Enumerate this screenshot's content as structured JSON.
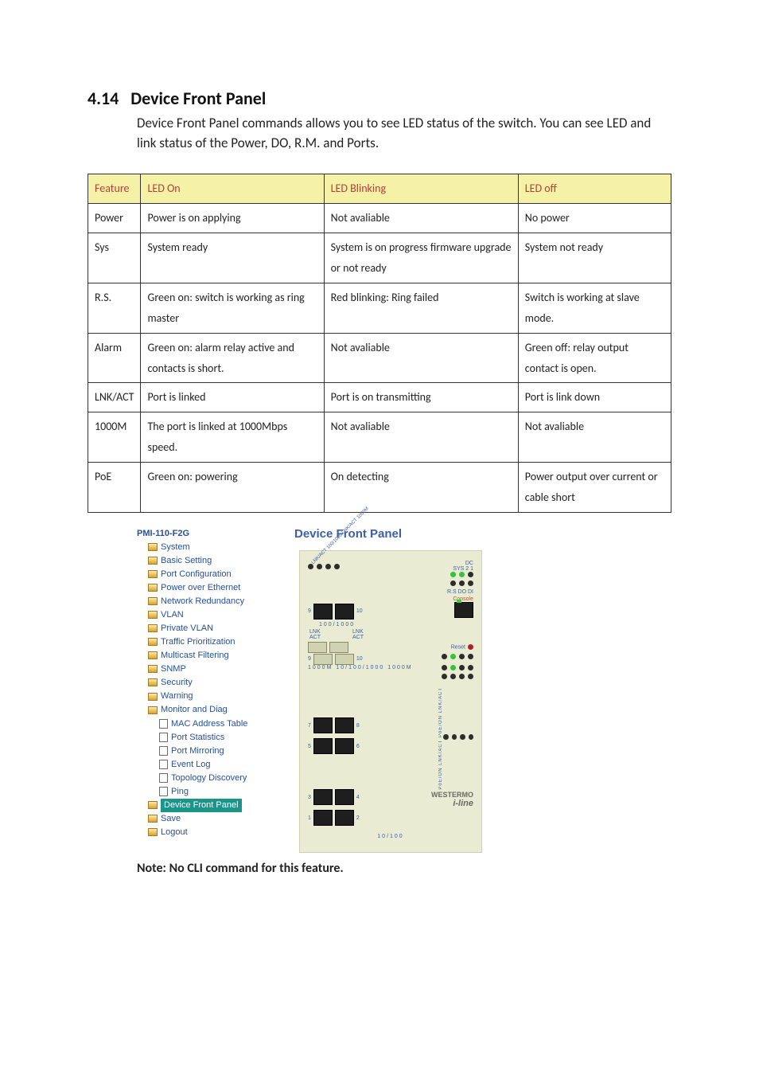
{
  "section": {
    "number": "4.14",
    "title": "Device Front Panel",
    "intro": "Device Front Panel commands allows you to see LED status of the switch. You can see LED and link status of the Power, DO, R.M. and Ports."
  },
  "table": {
    "headers": [
      "Feature",
      "LED On",
      "LED Blinking",
      "LED off"
    ],
    "rows": [
      {
        "feature": "Power",
        "on": "Power is on applying",
        "blink": "Not avaliable",
        "off": "No power"
      },
      {
        "feature": "Sys",
        "on": "System ready",
        "blink": "System is on progress firmware upgrade or not ready",
        "off": "System not ready"
      },
      {
        "feature": "R.S.",
        "on": "Green on: switch is working as ring master",
        "blink": "Red blinking: Ring failed",
        "off": "Switch is working at slave mode."
      },
      {
        "feature": "Alarm",
        "on": "Green on: alarm relay active and contacts is short.",
        "blink": "Not avaliable",
        "off": "Green off: relay output contact is open."
      },
      {
        "feature": "LNK/ACT",
        "on": "Port is linked",
        "blink": "Port is on transmitting",
        "off": "Port is link down"
      },
      {
        "feature": "1000M",
        "on": "The port is linked at 1000Mbps speed.",
        "blink": "Not avaliable",
        "off": "Not avaliable"
      },
      {
        "feature": "PoE",
        "on": "Green on: powering",
        "blink": "On detecting",
        "off": "Power output over current or cable short"
      }
    ]
  },
  "nav": {
    "root": "PMI-110-F2G",
    "lvl1": [
      "System",
      "Basic Setting",
      "Port Configuration",
      "Power over Ethernet",
      "Network Redundancy",
      "VLAN",
      "Private VLAN",
      "Traffic Prioritization",
      "Multicast Filtering",
      "SNMP",
      "Security",
      "Warning",
      "Monitor and Diag"
    ],
    "lvl2": [
      "MAC Address Table",
      "Port Statistics",
      "Port Mirroring",
      "Event Log",
      "Topology Discovery",
      "Ping"
    ],
    "selected": "Device Front Panel",
    "tail": [
      "Save",
      "Logout"
    ]
  },
  "panel": {
    "title": "Device Front Panel",
    "labels": {
      "top_leds": "LNK/ACT 100/1000 LNK/ACT 1000M",
      "dc": "DC",
      "sys21": "SYS  2  1",
      "rsdodi": "R.S DO DI",
      "console": "Console",
      "hundred_thousand": "100/1000",
      "lnk_act": "LNK\nACT",
      "reset": "Reset",
      "sfp_labels": "1000M   10/100/1000   1000M",
      "side_leds": "PoE/ON LNK/ACT PoE/ON LNK/ACT",
      "brand": "WESTERMO",
      "iline": "i-line",
      "bottom": "10/100",
      "port_pairs": [
        [
          "9",
          "10"
        ],
        [
          "9",
          "10"
        ],
        [
          "7",
          "8"
        ],
        [
          "5",
          "6"
        ],
        [
          "3",
          "4"
        ],
        [
          "1",
          "2"
        ]
      ]
    }
  },
  "note": "Note: No CLI command for this feature."
}
